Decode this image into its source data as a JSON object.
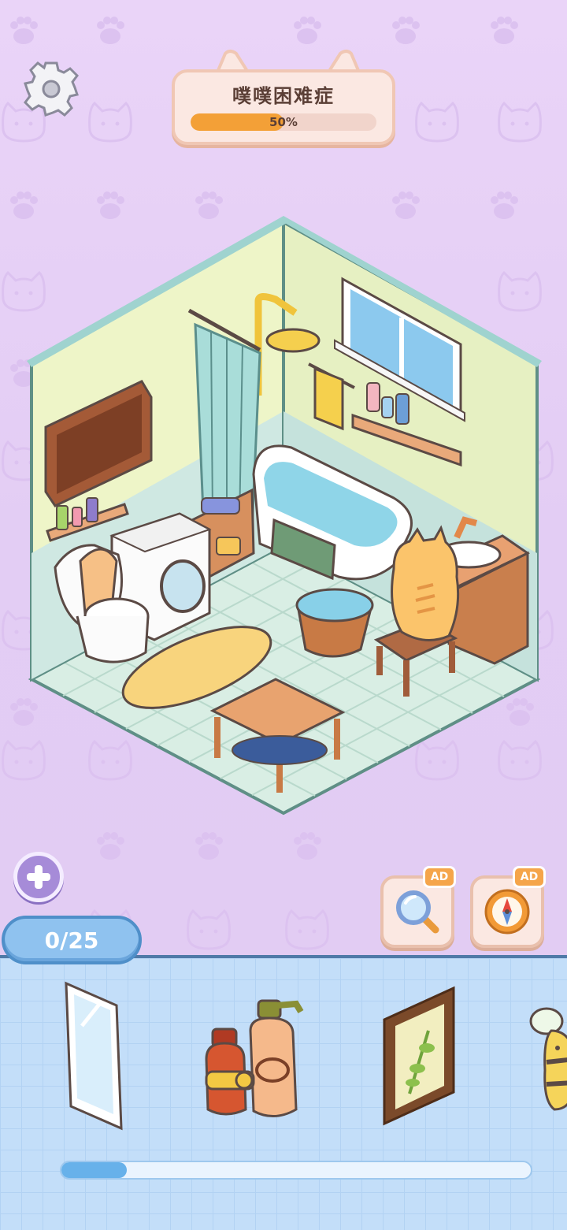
{
  "level": {
    "title": "噗噗困难症",
    "progress_label": "50%",
    "progress_value": 0.5
  },
  "found_counter": "0/25",
  "hint_buttons": [
    {
      "badge": "AD",
      "icon": "magnifier-icon"
    },
    {
      "badge": "AD",
      "icon": "compass-icon"
    }
  ],
  "tray": {
    "items": [
      {
        "icon": "mirror-icon"
      },
      {
        "icon": "shampoo-bottles-icon"
      },
      {
        "icon": "plant-picture-frame-icon"
      },
      {
        "icon": "bee-plush-icon"
      }
    ],
    "scroll_position": 0.14
  },
  "colors": {
    "progress_fill": "#f3a037",
    "counter_bg": "#8fc2ef",
    "tray_bg": "#c3def9",
    "room_wall": "#eef5c8",
    "ad_badge": "#f5a54a"
  }
}
